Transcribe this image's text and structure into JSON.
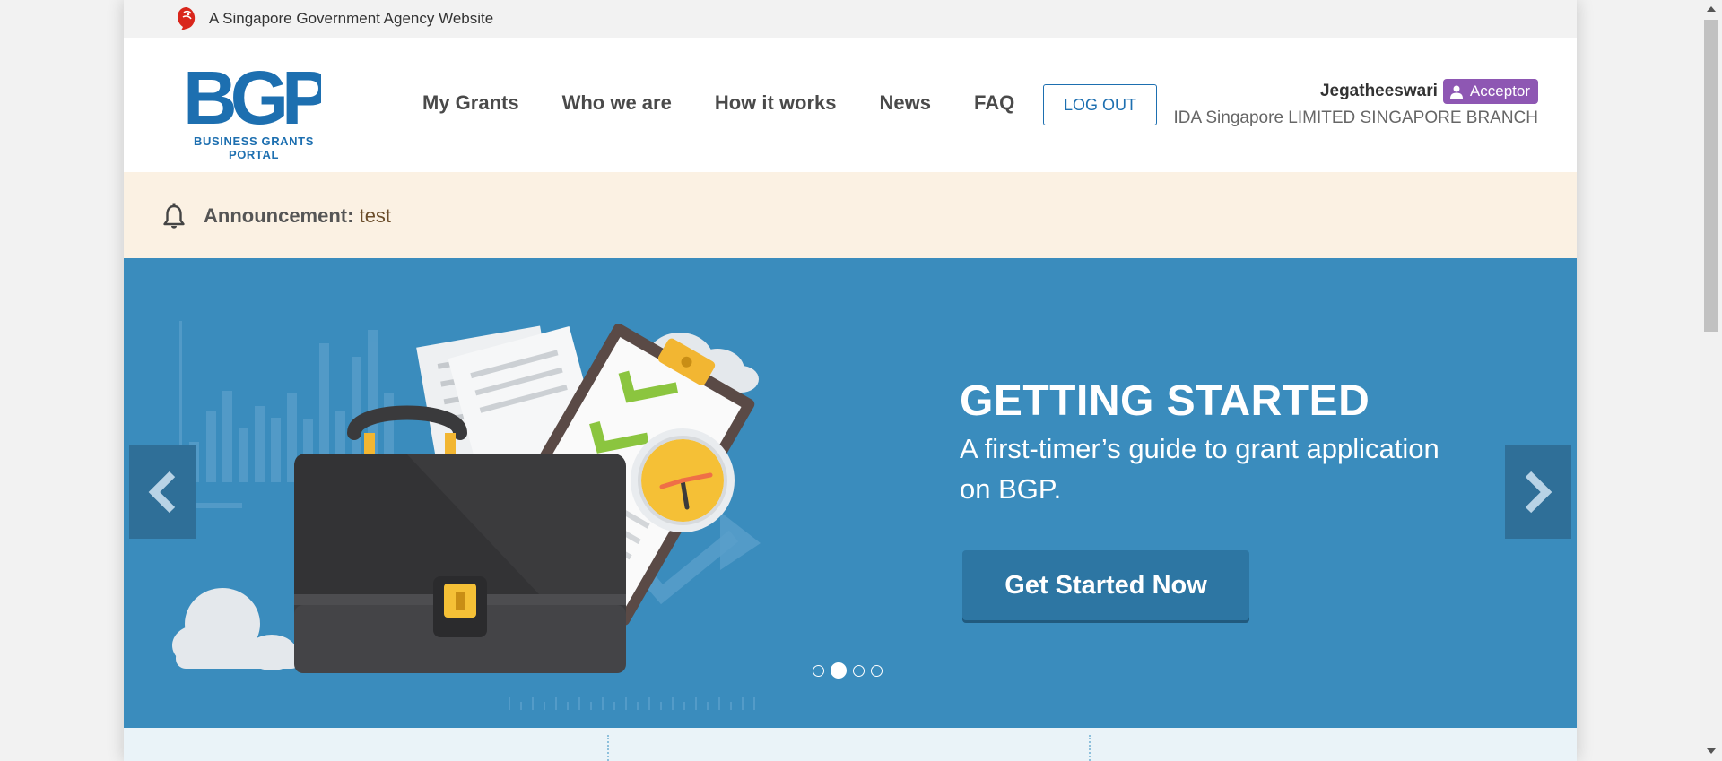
{
  "masthead": {
    "text": "A Singapore Government Agency Website"
  },
  "logo": {
    "mark": "BGP",
    "tagline": "BUSINESS GRANTS PORTAL"
  },
  "nav": [
    {
      "label": "My Grants"
    },
    {
      "label": "Who we are"
    },
    {
      "label": "How it works"
    },
    {
      "label": "News"
    },
    {
      "label": "FAQ"
    }
  ],
  "logout": {
    "label": "LOG OUT"
  },
  "user": {
    "name": "Jegatheeswari",
    "role": "Acceptor",
    "organisation": "IDA Singapore LIMITED SINGAPORE BRANCH"
  },
  "announcement": {
    "label": "Announcement:",
    "text": "test"
  },
  "hero": {
    "title": "GETTING STARTED",
    "subtitle": "A first-timer’s guide to grant application on BGP.",
    "cta": "Get Started Now",
    "slides_total": 4,
    "active_slide": 2
  },
  "colors": {
    "brand_blue": "#1d6fb0",
    "hero_bg": "#3a8cbd",
    "role_badge": "#8e57b3",
    "announcement_bg": "#fbf1e3"
  }
}
